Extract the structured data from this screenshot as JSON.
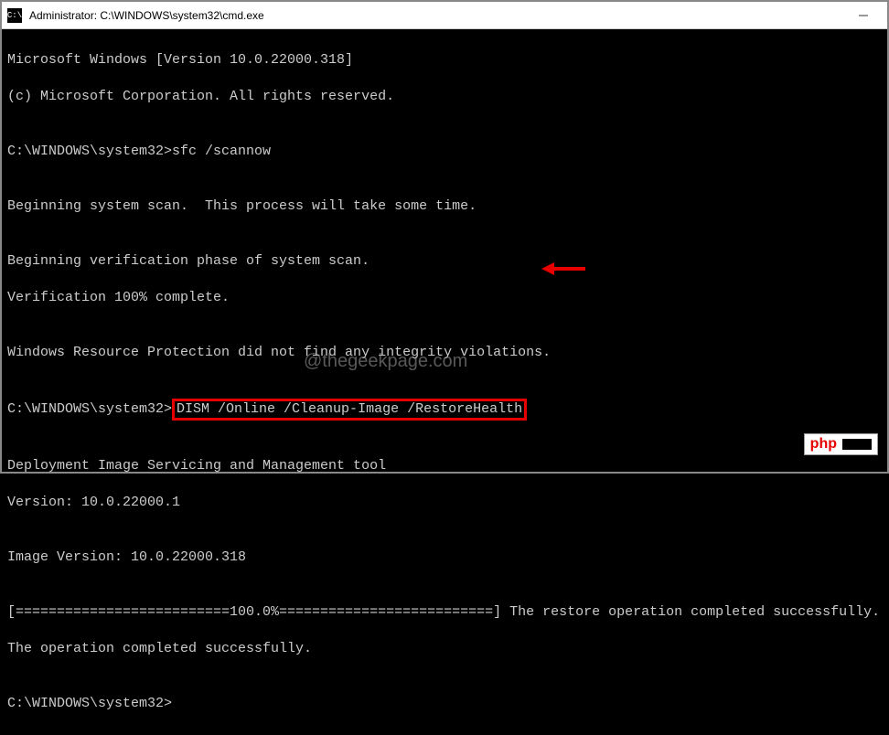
{
  "window": {
    "title": "Administrator: C:\\WINDOWS\\system32\\cmd.exe",
    "icon_label": "C:\\"
  },
  "terminal": {
    "line1": "Microsoft Windows [Version 10.0.22000.318]",
    "line2": "(c) Microsoft Corporation. All rights reserved.",
    "blank": "",
    "prompt1_path": "C:\\WINDOWS\\system32>",
    "prompt1_cmd": "sfc /scannow",
    "scan1": "Beginning system scan.  This process will take some time.",
    "scan2": "Beginning verification phase of system scan.",
    "scan3": "Verification 100% complete.",
    "scan4": "Windows Resource Protection did not find any integrity violations.",
    "prompt2_path": "C:\\WINDOWS\\system32>",
    "prompt2_cmd": "DISM /Online /Cleanup-Image /RestoreHealth",
    "dism1": "Deployment Image Servicing and Management tool",
    "dism2": "Version: 10.0.22000.1",
    "dism3": "Image Version: 10.0.22000.318",
    "progress": "[==========================100.0%==========================] The restore operation completed successfully.",
    "done": "The operation completed successfully.",
    "prompt3_path": "C:\\WINDOWS\\system32>"
  },
  "watermark": "@thegeekpage.com",
  "badge": {
    "text": "php"
  }
}
